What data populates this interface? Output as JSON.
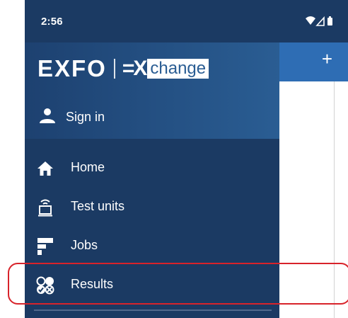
{
  "status_bar": {
    "time": "2:56"
  },
  "app_bar": {
    "add_label": "+"
  },
  "drawer": {
    "logo": {
      "brand": "EXFO",
      "ex": "=X",
      "change": "change"
    },
    "sign_in": "Sign in",
    "items": [
      {
        "label": "Home",
        "icon": "home-icon"
      },
      {
        "label": "Test units",
        "icon": "test-unit-icon"
      },
      {
        "label": "Jobs",
        "icon": "jobs-icon"
      },
      {
        "label": "Results",
        "icon": "results-icon"
      }
    ]
  },
  "colors": {
    "drawer": "#1b3a63",
    "app_bar": "#2e6db4",
    "highlight": "#d8232a"
  }
}
